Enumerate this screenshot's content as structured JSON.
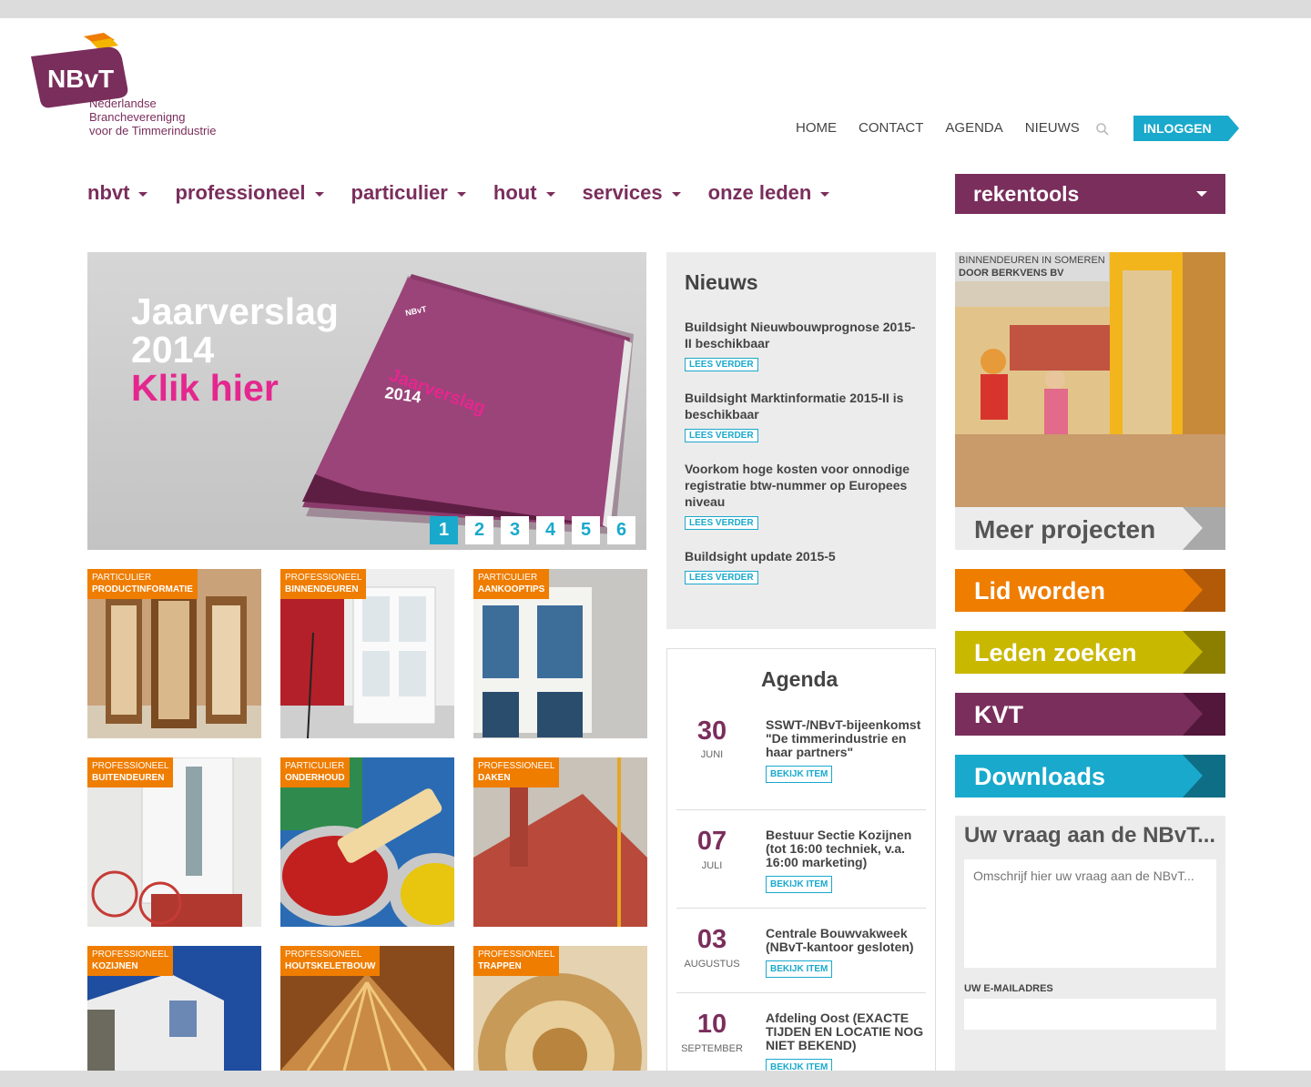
{
  "logo": {
    "brand": "NBvT",
    "line1": "Nederlandse",
    "line2": "Brancheverenigng",
    "line3": "voor de Timmerindustrie"
  },
  "topnav": {
    "home": "HOME",
    "contact": "CONTACT",
    "agenda": "AGENDA",
    "nieuws": "NIEUWS",
    "login": "INLOGGEN"
  },
  "mainnav": {
    "items": [
      "nbvt",
      "professioneel",
      "particulier",
      "hout",
      "services",
      "onze leden"
    ],
    "rekentools": "rekentools"
  },
  "slider": {
    "line1": "Jaarverslag",
    "line2": "2014",
    "line3": "Klik hier",
    "book_brand": "NBvT",
    "book_title": "Jaarverslag",
    "book_year": "2014",
    "pages": [
      "1",
      "2",
      "3",
      "4",
      "5",
      "6"
    ],
    "active_page": "1"
  },
  "tiles": [
    {
      "category": "PARTICULIER",
      "title": "PRODUCTINFORMATIE"
    },
    {
      "category": "PROFESSIONEEL",
      "title": "BINNENDEUREN"
    },
    {
      "category": "PARTICULIER",
      "title": "AANKOOPTIPS"
    },
    {
      "category": "PROFESSIONEEL",
      "title": "BUITENDEUREN"
    },
    {
      "category": "PARTICULIER",
      "title": "ONDERHOUD"
    },
    {
      "category": "PROFESSIONEEL",
      "title": "DAKEN"
    },
    {
      "category": "PROFESSIONEEL",
      "title": "KOZIJNEN"
    },
    {
      "category": "PROFESSIONEEL",
      "title": "HOUTSKELETBOUW"
    },
    {
      "category": "PROFESSIONEEL",
      "title": "TRAPPEN"
    }
  ],
  "news": {
    "heading": "Nieuws",
    "read_more": "LEES VERDER",
    "items": [
      "Buildsight Nieuwbouwprognose 2015-II beschikbaar",
      "Buildsight Marktinformatie 2015-II is beschikbaar",
      "Voorkom hoge kosten voor onnodige registratie btw-nummer op Europees niveau",
      "Buildsight update 2015-5"
    ]
  },
  "agenda": {
    "heading": "Agenda",
    "view_item": "BEKIJK ITEM",
    "items": [
      {
        "day": "30",
        "month": "JUNI",
        "title": "SSWT-/NBvT-bijeenkomst \"De timmerindustrie en haar partners\""
      },
      {
        "day": "07",
        "month": "JULI",
        "title": "Bestuur Sectie Kozijnen (tot 16:00 techniek, v.a. 16:00 marketing)"
      },
      {
        "day": "03",
        "month": "AUGUSTUS",
        "title": "Centrale Bouwvakweek (NBvT-kantoor gesloten)"
      },
      {
        "day": "10",
        "month": "SEPTEMBER",
        "title": "Afdeling Oost (EXACTE TIJDEN EN LOCATIE NOG NIET BEKEND)"
      }
    ]
  },
  "project": {
    "caption1": "BINNENDEUREN IN SOMEREN",
    "caption2": "DOOR BERKVENS BV",
    "more": "Meer projecten"
  },
  "cta": {
    "lid": "Lid worden",
    "leden": "Leden zoeken",
    "kvt": "KVT",
    "downloads": "Downloads"
  },
  "question": {
    "heading": "Uw vraag aan de NBvT...",
    "placeholder": "Omschrijf hier uw vraag aan de NBvT...",
    "email_label": "UW E-MAILADRES"
  },
  "colors": {
    "brand_purple": "#7a2e5c",
    "accent_cyan": "#19a9cc",
    "accent_orange": "#ef7d00",
    "accent_yellow": "#c9b800",
    "magenta": "#e4278e"
  }
}
